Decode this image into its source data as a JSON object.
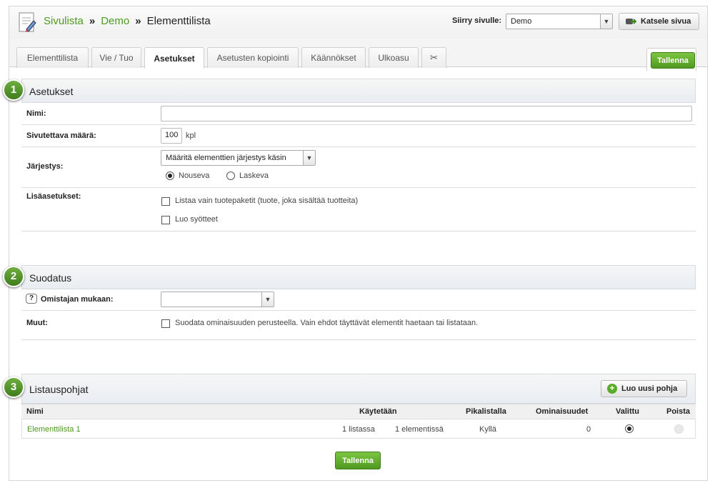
{
  "breadcrumb": {
    "root": "Sivulista",
    "middle": "Demo",
    "current": "Elementtilista"
  },
  "jump": {
    "label": "Siirry sivulle:",
    "value": "Demo"
  },
  "view_button": "Katsele sivua",
  "tabs": [
    "Elementtilista",
    "Vie / Tuo",
    "Asetukset",
    "Asetusten kopiointi",
    "Käännökset",
    "Ulkoasu"
  ],
  "save_label": "Tallenna",
  "settings": {
    "badge": "1",
    "title": "Asetukset",
    "name_label": "Nimi:",
    "name_value": "",
    "perpage_label": "Sivutettava määrä:",
    "perpage_value": "100",
    "perpage_unit": "kpl",
    "order_label": "Järjestys:",
    "order_select": "Määritä elementtien järjestys käsin",
    "asc_label": "Nouseva",
    "desc_label": "Laskeva",
    "extra_label": "Lisäasetukset:",
    "opt1": "Listaa vain tuotepaketit (tuote, joka sisältää tuotteita)",
    "opt2": "Luo syötteet"
  },
  "filter": {
    "badge": "2",
    "title": "Suodatus",
    "help": "?",
    "owner_label": "Omistajan mukaan:",
    "owner_value": "",
    "other_label": "Muut:",
    "other_opt": "Suodata ominaisuuden perusteella. Vain ehdot täyttävät elementit haetaan tai listataan."
  },
  "templates": {
    "badge": "3",
    "title": "Listauspohjat",
    "new_button": "Luo uusi pohja",
    "headers": {
      "name": "Nimi",
      "used": "Käytetään",
      "quick": "Pikalistalla",
      "props": "Ominaisuudet",
      "selected": "Valittu",
      "delete": "Poista"
    },
    "rows": [
      {
        "name": "Elementtilista 1",
        "lists": "1 listassa",
        "elements": "1 elementissä",
        "quick": "Kyllä",
        "props": "0"
      }
    ]
  },
  "colors": {
    "accent": "#4d9a1f",
    "button_green": "#5aab28"
  }
}
